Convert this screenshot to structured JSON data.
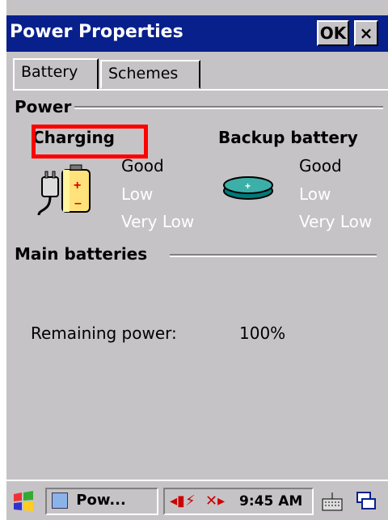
{
  "window": {
    "title": "Power Properties",
    "ok_label": "OK",
    "close_label": "×"
  },
  "tabs": [
    {
      "label": "Battery",
      "active": true
    },
    {
      "label": "Schemes",
      "active": false
    }
  ],
  "power_section": {
    "title": "Power",
    "main": {
      "status": "Charging",
      "levels": [
        "Good",
        "Low",
        "Very Low"
      ],
      "active_level": "Good",
      "icon": "battery-charging-icon"
    },
    "backup": {
      "title": "Backup battery",
      "levels": [
        "Good",
        "Low",
        "Very Low"
      ],
      "active_level": "Good",
      "icon": "coin-cell-battery-icon"
    }
  },
  "main_batteries": {
    "title": "Main batteries",
    "remaining_label": "Remaining power:",
    "remaining_value": "100%"
  },
  "taskbar": {
    "start_icon": "windows-flag-icon",
    "app_label": "Pow...",
    "time": "9:45 AM",
    "icons": [
      "power-plug-icon",
      "network-icon",
      "keyboard-icon",
      "window-switch-icon"
    ]
  },
  "colors": {
    "titlebar": "#08208c",
    "dialog": "#c6c3c6",
    "highlight": "#ff0000"
  }
}
